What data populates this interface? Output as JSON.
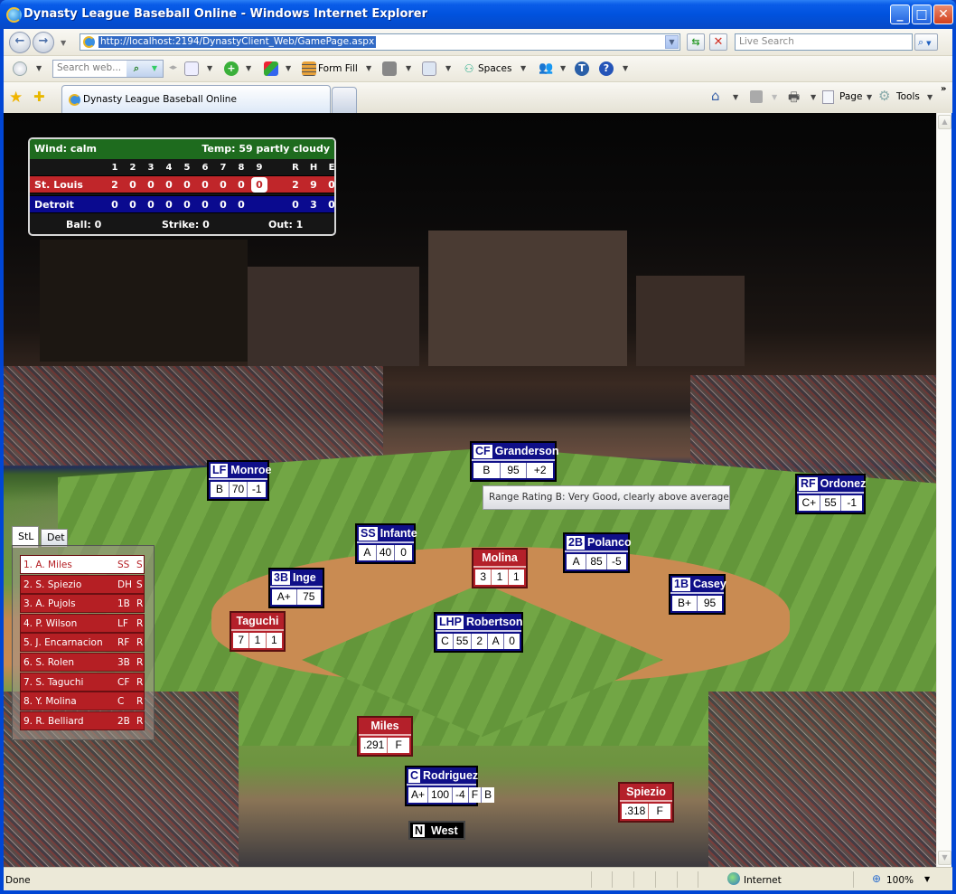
{
  "window": {
    "title": "Dynasty League Baseball Online - Windows Internet Explorer",
    "minimize": "_",
    "maximize": "□",
    "close": "✕"
  },
  "nav": {
    "back_icon": "←",
    "forward_icon": "→",
    "url": "http://localhost:2194/DynastyClient_Web/GamePage.aspx",
    "refresh_icon": "⇆",
    "stop_icon": "✕",
    "live_search_placeholder": "Live Search",
    "search_icon": "⌕"
  },
  "toolbar": {
    "web_search_placeholder": "Search web...",
    "form_fill": "Form Fill",
    "spaces": "Spaces"
  },
  "tabs": {
    "active": "Dynasty League Baseball Online",
    "page": "Page",
    "tools": "Tools",
    "more": "»"
  },
  "scoreboard": {
    "wind": "Wind: calm",
    "temp": "Temp: 59 partly cloudy",
    "innings": [
      "1",
      "2",
      "3",
      "4",
      "5",
      "6",
      "7",
      "8",
      "9"
    ],
    "totals_headers": [
      "R",
      "H",
      "E"
    ],
    "current_inning": 9,
    "teams": [
      {
        "name": "St. Louis",
        "scores": [
          "2",
          "0",
          "0",
          "0",
          "0",
          "0",
          "0",
          "0",
          "0"
        ],
        "R": "2",
        "H": "9",
        "E": "0",
        "color": "#c0262a"
      },
      {
        "name": "Detroit",
        "scores": [
          "0",
          "0",
          "0",
          "0",
          "0",
          "0",
          "0",
          "0",
          ""
        ],
        "R": "0",
        "H": "3",
        "E": "0",
        "color": "#0a0a8f"
      }
    ],
    "ball": "Ball: 0",
    "strike": "Strike: 0",
    "out": "Out: 1"
  },
  "lineup": {
    "tabs": [
      "StL",
      "Det"
    ],
    "active_tab": "StL",
    "rows": [
      {
        "name": "1. A. Miles",
        "pos": "SS",
        "bats": "S",
        "selected": true
      },
      {
        "name": "2. S. Spiezio",
        "pos": "DH",
        "bats": "S"
      },
      {
        "name": "3. A. Pujols",
        "pos": "1B",
        "bats": "R"
      },
      {
        "name": "4. P. Wilson",
        "pos": "LF",
        "bats": "R"
      },
      {
        "name": "5. J. Encarnacion",
        "pos": "RF",
        "bats": "R"
      },
      {
        "name": "6. S. Rolen",
        "pos": "3B",
        "bats": "R"
      },
      {
        "name": "7. S. Taguchi",
        "pos": "CF",
        "bats": "R"
      },
      {
        "name": "8. Y. Molina",
        "pos": "C",
        "bats": "R"
      },
      {
        "name": "9. R. Belliard",
        "pos": "2B",
        "bats": "R"
      }
    ]
  },
  "fielders": [
    {
      "id": "cf",
      "pos": "CF",
      "name": "Granderson",
      "stats": [
        "B",
        "95",
        "+2"
      ]
    },
    {
      "id": "lf",
      "pos": "LF",
      "name": "Monroe",
      "stats": [
        "B",
        "70",
        "-1"
      ]
    },
    {
      "id": "rf",
      "pos": "RF",
      "name": "Ordonez",
      "stats": [
        "C+",
        "55",
        "-1"
      ]
    },
    {
      "id": "ss",
      "pos": "SS",
      "name": "Infante",
      "stats": [
        "A",
        "40",
        "0"
      ]
    },
    {
      "id": "2b",
      "pos": "2B",
      "name": "Polanco",
      "stats": [
        "A",
        "85",
        "-5"
      ]
    },
    {
      "id": "3b",
      "pos": "3B",
      "name": "Inge",
      "stats": [
        "A+",
        "75"
      ]
    },
    {
      "id": "1b",
      "pos": "1B",
      "name": "Casey",
      "stats": [
        "B+",
        "95"
      ]
    },
    {
      "id": "p",
      "pos": "LHP",
      "name": "Robertson",
      "stats": [
        "C",
        "55",
        "2",
        "A",
        "0"
      ]
    },
    {
      "id": "c",
      "pos": "C",
      "name": "Rodriguez",
      "stats": [
        "A+",
        "100",
        "-4",
        "F",
        "B"
      ]
    }
  ],
  "runners": [
    {
      "id": "molina",
      "name": "Molina",
      "stats": [
        "3",
        "1",
        "1"
      ]
    },
    {
      "id": "taguchi",
      "name": "Taguchi",
      "stats": [
        "7",
        "1",
        "1"
      ]
    },
    {
      "id": "miles",
      "name": "Miles",
      "stats": [
        ".291",
        "F"
      ]
    },
    {
      "id": "spiezio",
      "name": "Spiezio",
      "stats": [
        ".318",
        "F"
      ]
    }
  ],
  "tooltip": "Range Rating B: Very Good, clearly above average",
  "umpire": {
    "badge": "N",
    "name": "West"
  },
  "status": {
    "text": "Done",
    "zone": "Internet",
    "zoom": "100%"
  }
}
